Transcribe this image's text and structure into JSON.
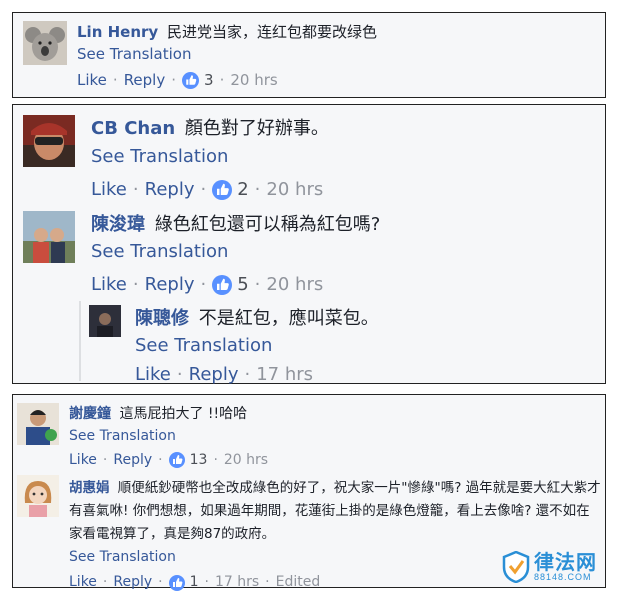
{
  "comments": [
    {
      "name": "Lin Henry",
      "text": "民进党当家，连红包都要改绿色",
      "see_translation": "See Translation",
      "like": "Like",
      "reply": "Reply",
      "likes": "3",
      "time": "20 hrs"
    },
    {
      "name": "CB Chan",
      "text": "顏色對了好辦事。",
      "see_translation": "See Translation",
      "like": "Like",
      "reply": "Reply",
      "likes": "2",
      "time": "20 hrs"
    },
    {
      "name": "陳浚瑋",
      "text": "綠色紅包還可以稱為紅包嗎?",
      "see_translation": "See Translation",
      "like": "Like",
      "reply": "Reply",
      "likes": "5",
      "time": "20 hrs"
    },
    {
      "name": "陳聰修",
      "text": "不是紅包，應叫菜包。",
      "see_translation": "See Translation",
      "like": "Like",
      "reply": "Reply",
      "time": "17 hrs"
    },
    {
      "name": "謝慶鐘",
      "text": "這馬屁拍大了 !!哈哈",
      "see_translation": "See Translation",
      "like": "Like",
      "reply": "Reply",
      "likes": "13",
      "time": "20 hrs"
    },
    {
      "name": "胡惠娟",
      "text": "順便紙鈔硬幣也全改成綠色的好了，祝大家一片\"慘綠\"嗎? 過年就是要大紅大紫才有喜氣咻! 你們想想，如果過年期間，花蓮街上掛的是綠色燈籠，看上去像啥? 還不如在家看電視算了，真是夠87的政府。",
      "see_translation": "See Translation",
      "like": "Like",
      "reply": "Reply",
      "likes": "1",
      "time": "17 hrs",
      "edited": "Edited"
    }
  ],
  "watermark": {
    "main": "律法网",
    "sub": "88148.COM"
  },
  "colors": {
    "link": "#365899",
    "like_badge": "#5890ff",
    "meta": "#90949c"
  }
}
